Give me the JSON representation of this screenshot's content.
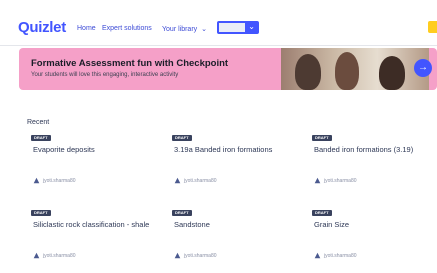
{
  "header": {
    "logo": "Quizlet",
    "nav": {
      "home": "Home",
      "expert": "Expert solutions",
      "library": "Your library"
    },
    "brand_color": "#4255ff"
  },
  "banner": {
    "title": "Formative Assessment fun with Checkpoint",
    "subtitle": "Your students will love this engaging, interactive activity",
    "background": "#f5a0c8"
  },
  "recent": {
    "heading": "Recent",
    "items": [
      {
        "badge": "DRAFT",
        "title": "Evaporite deposits",
        "author": "jyoti.sharma80"
      },
      {
        "badge": "DRAFT",
        "title": "3.19a Banded iron formations",
        "author": "jyoti.sharma80"
      },
      {
        "badge": "DRAFT",
        "title": "Banded iron formations (3.19)",
        "author": "jyoti.sharma80"
      },
      {
        "badge": "DRAFT",
        "title": "Siliclastic rock classification - shale",
        "author": "jyoti.sharma80"
      },
      {
        "badge": "DRAFT",
        "title": "Sandstone",
        "author": "jyoti.sharma80"
      },
      {
        "badge": "DRAFT",
        "title": "Grain Size",
        "author": "jyoti.sharma80"
      }
    ]
  }
}
